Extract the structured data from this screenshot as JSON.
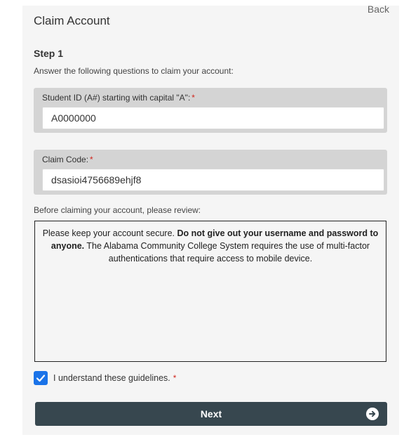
{
  "header": {
    "back_label": "Back",
    "title": "Claim Account"
  },
  "step": {
    "title": "Step 1",
    "intro": "Answer the following questions to claim your account:"
  },
  "fields": {
    "student_id": {
      "label": "Student ID (A#) starting with capital \"A\":",
      "required_mark": "*",
      "value": "A0000000"
    },
    "claim_code": {
      "label": "Claim Code:",
      "required_mark": "*",
      "value": "dsasioi4756689ehjf8"
    }
  },
  "review": {
    "label": "Before claiming your account, please review:",
    "text_part1": "Please keep your account secure. ",
    "text_bold": "Do not give out your username and password to anyone.",
    "text_part2": " The Alabama Community College System requires the use of multi-factor authentications that require access to mobile device."
  },
  "acknowledge": {
    "label": "I understand these guidelines.",
    "required_mark": "*",
    "checked": true
  },
  "actions": {
    "next_label": "Next"
  },
  "colors": {
    "panel_bg": "#f5f5f5",
    "field_group_bg": "#d4d4d4",
    "required": "#d0261d",
    "checkbox": "#1a73e8",
    "next_button": "#37474f"
  },
  "icons": {
    "checkbox": "check-icon",
    "next": "arrow-right-circle-icon"
  }
}
